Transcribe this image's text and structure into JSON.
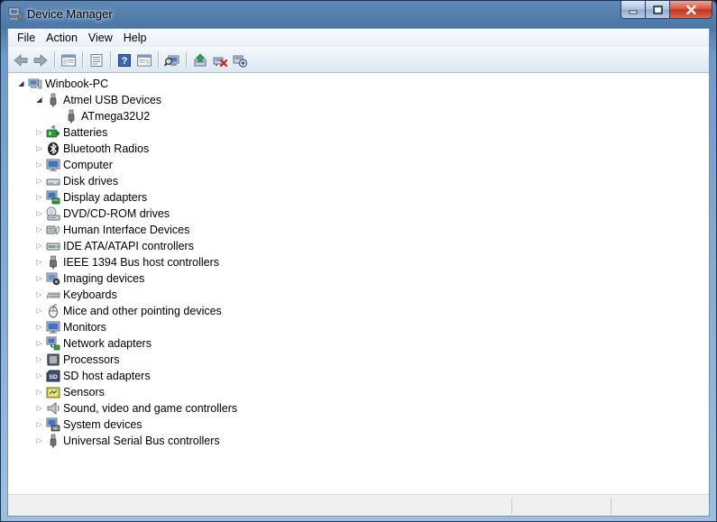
{
  "window": {
    "title": "Device Manager",
    "controls": {
      "minimize": "minimize-icon",
      "maximize": "maximize-icon",
      "close": "close-icon"
    }
  },
  "menu": [
    {
      "id": "file",
      "label": "File"
    },
    {
      "id": "action",
      "label": "Action"
    },
    {
      "id": "view",
      "label": "View"
    },
    {
      "id": "help",
      "label": "Help"
    }
  ],
  "toolbar": [
    {
      "id": "back",
      "icon": "back-arrow-icon"
    },
    {
      "id": "forward",
      "icon": "forward-arrow-icon"
    },
    {
      "id": "show-hide-console-tree",
      "icon": "console-tree-icon"
    },
    {
      "id": "properties",
      "icon": "properties-icon"
    },
    {
      "id": "help",
      "icon": "help-icon"
    },
    {
      "id": "show-action-pane",
      "icon": "action-pane-icon"
    },
    {
      "id": "scan-hardware",
      "icon": "scan-hardware-icon"
    },
    {
      "id": "update-driver",
      "icon": "update-driver-icon"
    },
    {
      "id": "uninstall",
      "icon": "uninstall-icon"
    },
    {
      "id": "disable",
      "icon": "disable-device-icon"
    }
  ],
  "tree": {
    "root": {
      "label": "Winbook-PC",
      "icon": "computer-icon"
    },
    "categories": [
      {
        "label": "Atmel USB Devices",
        "icon": "usb-plug-icon",
        "expanded": true,
        "children": [
          {
            "label": "ATmega32U2",
            "icon": "usb-plug-icon"
          }
        ]
      },
      {
        "label": "Batteries",
        "icon": "battery-icon"
      },
      {
        "label": "Bluetooth Radios",
        "icon": "bluetooth-icon"
      },
      {
        "label": "Computer",
        "icon": "monitor-icon"
      },
      {
        "label": "Disk drives",
        "icon": "disk-drive-icon"
      },
      {
        "label": "Display adapters",
        "icon": "display-adapter-icon"
      },
      {
        "label": "DVD/CD-ROM drives",
        "icon": "dvd-drive-icon"
      },
      {
        "label": "Human Interface Devices",
        "icon": "hid-icon"
      },
      {
        "label": "IDE ATA/ATAPI controllers",
        "icon": "ide-controller-icon"
      },
      {
        "label": "IEEE 1394 Bus host controllers",
        "icon": "firewire-icon"
      },
      {
        "label": "Imaging devices",
        "icon": "camera-icon"
      },
      {
        "label": "Keyboards",
        "icon": "keyboard-icon"
      },
      {
        "label": "Mice and other pointing devices",
        "icon": "mouse-icon"
      },
      {
        "label": "Monitors",
        "icon": "monitor-icon"
      },
      {
        "label": "Network adapters",
        "icon": "network-adapter-icon"
      },
      {
        "label": "Processors",
        "icon": "processor-icon"
      },
      {
        "label": "SD host adapters",
        "icon": "sd-card-icon"
      },
      {
        "label": "Sensors",
        "icon": "sensor-icon"
      },
      {
        "label": "Sound, video and game controllers",
        "icon": "speaker-icon"
      },
      {
        "label": "System devices",
        "icon": "system-devices-icon"
      },
      {
        "label": "Universal Serial Bus controllers",
        "icon": "usb-plug-icon"
      }
    ]
  }
}
